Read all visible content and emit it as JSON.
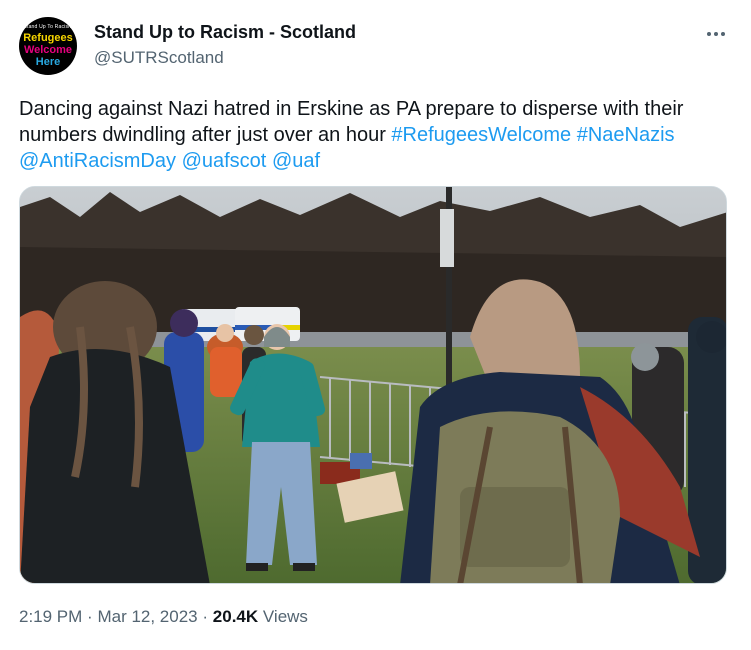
{
  "author": {
    "avatar": {
      "top_text": "Stand Up To Racism",
      "line1": "Refugees",
      "line2": "Welcome",
      "line3": "Here"
    },
    "name": "Stand Up to Racism - Scotland",
    "handle": "@SUTRScotland"
  },
  "more_icon": "ellipsis-icon",
  "tweet": {
    "text_part1": "Dancing against Nazi hatred in Erskine as PA prepare to disperse with their numbers dwindling after just over an hour ",
    "hashtags": [
      "#RefugeesWelcome",
      "#NaeNazis",
      "@AntiRacismDay",
      "@uafscot",
      "@uaf"
    ]
  },
  "media": {
    "kind": "video-thumbnail",
    "scene": "protest-in-park"
  },
  "meta": {
    "time": "2:19 PM",
    "date": "Mar 12, 2023",
    "separator": "·",
    "views_count": "20.4K",
    "views_label": "Views"
  }
}
